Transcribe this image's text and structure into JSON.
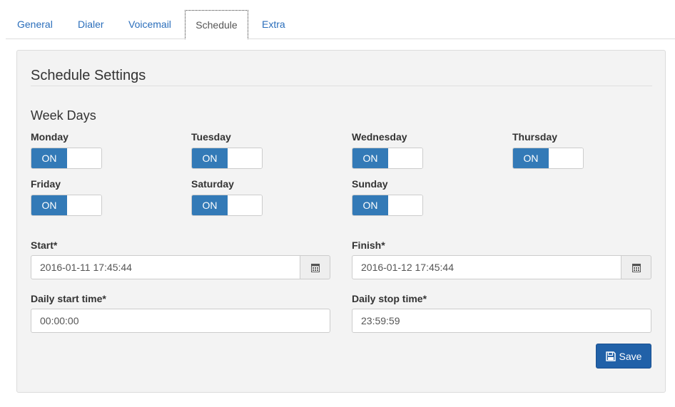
{
  "tabs": [
    {
      "label": "General"
    },
    {
      "label": "Dialer"
    },
    {
      "label": "Voicemail"
    },
    {
      "label": "Schedule"
    },
    {
      "label": "Extra"
    }
  ],
  "panel": {
    "title": "Schedule Settings",
    "week_days_title": "Week Days",
    "toggle_on_label": "ON",
    "days": [
      {
        "label": "Monday",
        "state": "ON"
      },
      {
        "label": "Tuesday",
        "state": "ON"
      },
      {
        "label": "Wednesday",
        "state": "ON"
      },
      {
        "label": "Thursday",
        "state": "ON"
      },
      {
        "label": "Friday",
        "state": "ON"
      },
      {
        "label": "Saturday",
        "state": "ON"
      },
      {
        "label": "Sunday",
        "state": "ON"
      }
    ],
    "start": {
      "label": "Start*",
      "value": "2016-01-11 17:45:44"
    },
    "finish": {
      "label": "Finish*",
      "value": "2016-01-12 17:45:44"
    },
    "daily_start": {
      "label": "Daily start time*",
      "value": "00:00:00"
    },
    "daily_stop": {
      "label": "Daily stop time*",
      "value": "23:59:59"
    },
    "save_label": "Save"
  },
  "colors": {
    "accent": "#337ab7",
    "save_button": "#2161a8",
    "tab_link": "#2a6ebb"
  }
}
